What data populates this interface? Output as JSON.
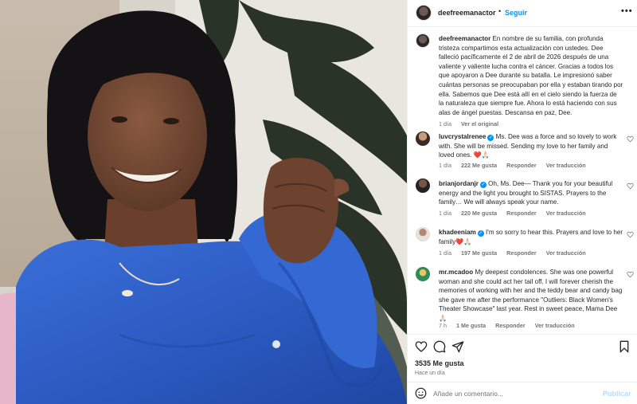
{
  "post": {
    "username": "deefreemanactor",
    "follow_label": "Seguir",
    "separator": "•",
    "more_label": "•••",
    "caption": "En nombre de su familia, con profunda tristeza compartimos esta actualización con ustedes. Dee falleció pacíficamente el 2 de abril de 2026 después de una valiente y valiente lucha contra el cáncer. Gracias a todos los que apoyaron a Dee durante su batalla. Le impresionó saber cuántas personas se preocupaban por ella y estaban tirando por ella. Sabemos que Dee está allí en el cielo siendo la fuerza de la naturaleza que siempre fue. Ahora lo está haciendo con sus alas de ángel puestas. Descansa en paz, Dee.",
    "caption_time": "1 día",
    "caption_translate": "Ver el original"
  },
  "comments": [
    {
      "username": "luvcrystalrenee",
      "verified": true,
      "text": "Ms. Dee was a force and so lovely to work with. She will be missed. Sending my love to her family and loved ones. ❤️🙏🏻",
      "time": "1 día",
      "likes": "222 Me gusta",
      "reply": "Responder",
      "translate": "Ver traducción"
    },
    {
      "username": "brianjordanjr",
      "verified": true,
      "text": "Oh, Ms. Dee— Thank you for your beautiful energy and the light you brought to SISTAS. Prayers to the family… We will always speak your name.",
      "time": "1 día",
      "likes": "220 Me gusta",
      "reply": "Responder",
      "translate": "Ver traducción"
    },
    {
      "username": "khadeeniam",
      "verified": true,
      "text": "I'm so sorry to hear this. Prayers and love to her family❤️🙏🏻",
      "time": "1 día",
      "likes": "197 Me gusta",
      "reply": "Responder",
      "translate": "Ver traducción"
    },
    {
      "username": "mr.mcadoo",
      "verified": false,
      "text": "My deepest condolences. She was one powerful woman and she could act her tail off. I will forever cherish the memories of working with her and the teddy bear and candy bag she gave me after the performance \"Outliers: Black Women's Theater Showcase\" last year. Rest in sweet peace, Mama Dee 🙏🏻",
      "time": "7 h",
      "likes": "1 Me gusta",
      "reply": "Responder",
      "translate": "Ver traducción"
    }
  ],
  "actions": {
    "likes": "3535 Me gusta",
    "timestamp": "Hace un día",
    "icons": [
      "heart-icon",
      "comment-icon",
      "share-icon",
      "bookmark-icon"
    ]
  },
  "add_comment": {
    "placeholder": "Añade un comentario...",
    "post_label": "Publicar"
  },
  "colors": {
    "accent": "#0095f6",
    "post_disabled": "#b3dbff",
    "dress": "#2f5fc4",
    "text_muted": "#737373"
  }
}
